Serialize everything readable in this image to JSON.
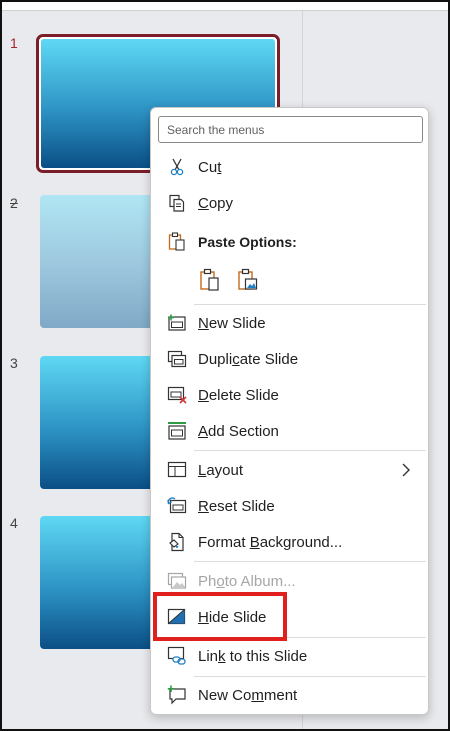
{
  "slides": [
    {
      "number": "1",
      "selected": true,
      "hidden": false
    },
    {
      "number": "2",
      "selected": false,
      "hidden": true
    },
    {
      "number": "3",
      "selected": false,
      "hidden": false
    },
    {
      "number": "4",
      "selected": false,
      "hidden": false
    }
  ],
  "menu": {
    "search_placeholder": "Search the menus",
    "cut": {
      "pre": "Cu",
      "key": "t",
      "post": ""
    },
    "copy": {
      "pre": "",
      "key": "C",
      "post": "opy"
    },
    "paste_options_label": "Paste Options:",
    "new_slide": {
      "pre": "",
      "key": "N",
      "post": "ew Slide"
    },
    "duplicate_slide": {
      "pre": "Dupli",
      "key": "c",
      "post": "ate Slide"
    },
    "delete_slide": {
      "pre": "",
      "key": "D",
      "post": "elete Slide"
    },
    "add_section": {
      "pre": "",
      "key": "A",
      "post": "dd Section"
    },
    "layout": {
      "pre": "",
      "key": "L",
      "post": "ayout"
    },
    "reset_slide": {
      "pre": "",
      "key": "R",
      "post": "eset Slide"
    },
    "format_background": {
      "pre": "Format ",
      "key": "B",
      "post": "ackground..."
    },
    "photo_album": {
      "pre": "Ph",
      "key": "o",
      "post": "to Album..."
    },
    "hide_slide": {
      "pre": "",
      "key": "H",
      "post": "ide Slide"
    },
    "link_to_slide": {
      "pre": "Lin",
      "key": "k",
      "post": " to this Slide"
    },
    "new_comment": {
      "pre": "New Co",
      "key": "m",
      "post": "ment"
    }
  },
  "colors": {
    "highlight": "#e01f1f",
    "selected_border": "#7a1f2a",
    "slide_gradient_top": "#5fd8f4",
    "slide_gradient_bottom": "#0b4f86"
  }
}
